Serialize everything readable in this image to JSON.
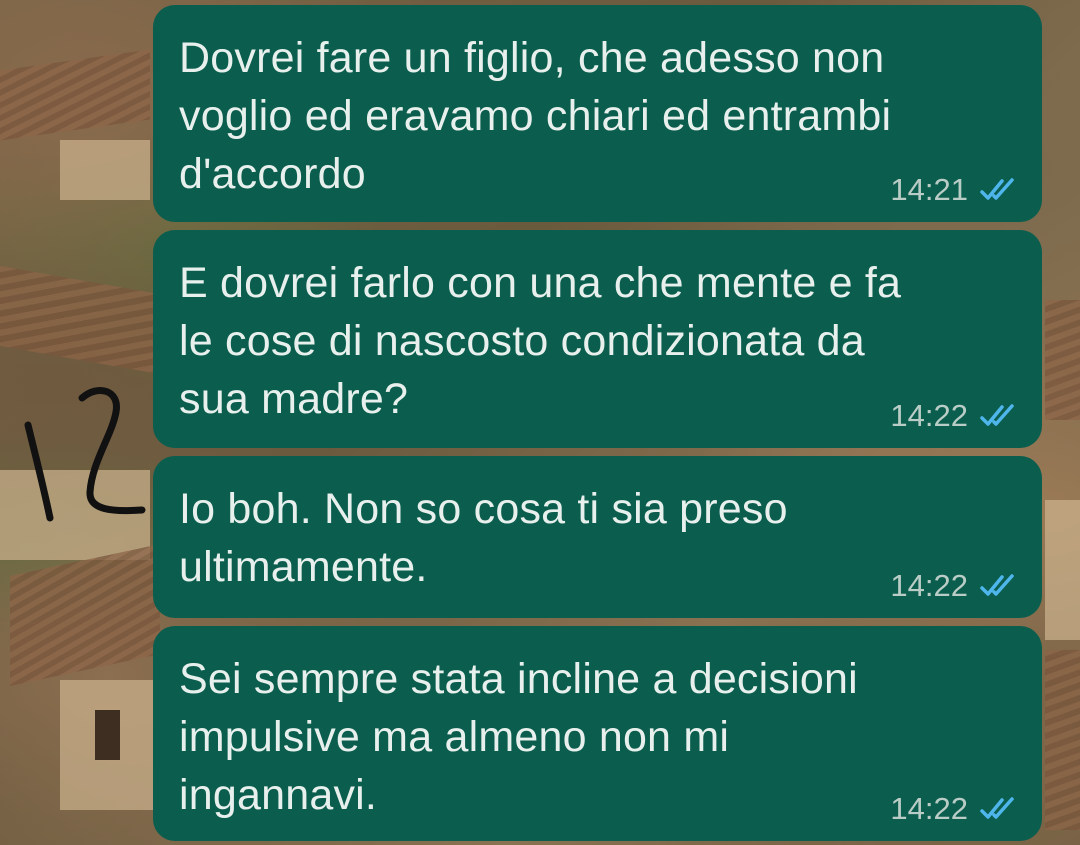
{
  "messages": [
    {
      "text": "Dovrei fare un figlio, che adesso non\nvoglio ed eravamo chiari ed entrambi\nd'accordo",
      "time": "14:21",
      "status": "read-double-check-icon"
    },
    {
      "text": "E dovrei farlo con una che mente e fa\nle cose di nascosto condizionata da\nsua madre?",
      "time": "14:22",
      "status": "read-double-check-icon"
    },
    {
      "text": "Io boh. Non so cosa ti sia preso\nultimamente.",
      "time": "14:22",
      "status": "read-double-check-icon"
    },
    {
      "text": "Sei sempre stata incline a decisioni\nimpulsive ma almeno non mi\ningannavi.",
      "time": "14:22",
      "status": "read-double-check-icon"
    }
  ],
  "annotation": {
    "text": "12"
  },
  "colors": {
    "bubble": "#0b5d4e",
    "text": "#e7f0ec",
    "time": "#b9cdc6",
    "ticks": "#4fb6ec"
  }
}
